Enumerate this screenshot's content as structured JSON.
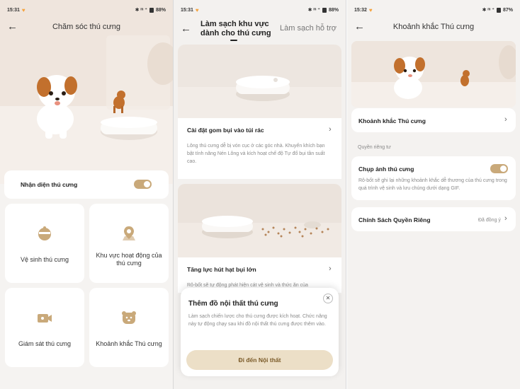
{
  "status": {
    "p1": {
      "time": "15:31",
      "indicators": "✱ ᵐ ⁺",
      "battery": "88%"
    },
    "p2": {
      "time": "15:31",
      "indicators": "✱ ᵐ ⁺",
      "battery": "88%"
    },
    "p3": {
      "time": "15:32",
      "indicators": "✱ ᵐ ⁺",
      "battery": "87%"
    }
  },
  "panel1": {
    "title": "Chăm sóc thú cưng",
    "recognition": {
      "label": "Nhận diện thú cưng",
      "enabled": true
    },
    "tiles": [
      {
        "label": "Vệ sinh thú cưng",
        "icon": "pet-cleaning-icon"
      },
      {
        "label": "Khu vực hoạt động của thú cưng",
        "icon": "location-pin-icon"
      },
      {
        "label": "Giám sát thú cưng",
        "icon": "video-camera-icon"
      },
      {
        "label": "Khoảnh khắc Thú cưng",
        "icon": "pet-face-icon"
      }
    ]
  },
  "panel2": {
    "tab_active": "Làm sạch khu vực dành cho thú cưng",
    "tab_inactive": "Làm sạch hỗ trợ",
    "features": [
      {
        "title": "Cài đặt gom bụi vào túi rác",
        "desc": "Lông thú cưng dễ bị vón cục ở các góc nhà. Khuyến khích bạn bật tính năng Nén Lông và kích hoạt chế độ Tự đổ bụi tần suất cao."
      },
      {
        "title": "Tăng lực hút hạt bụi lớn",
        "desc": "Rô-bốt sẽ tự động phát hiện cát vệ sinh và thức ăn của"
      }
    ],
    "popup": {
      "title": "Thêm đồ nội thất thú cưng",
      "desc": "Làm sạch chiến lược cho thú cưng được kích hoạt. Chức năng này tự động chạy sau khi đồ nội thất thú cưng được thêm vào.",
      "button": "Đi đến Nội thất"
    }
  },
  "panel3": {
    "title": "Khoảnh khắc Thú cưng",
    "moments_row": "Khoảnh khắc Thú cưng",
    "privacy_section": "Quyền riêng tư",
    "photo": {
      "label": "Chụp ảnh thú cưng",
      "enabled": true,
      "desc": "Rô-bốt sẽ ghi lại những khoảnh khắc dễ thương của thú cưng trong quá trình vệ sinh và lưu chúng dưới dạng GIF."
    },
    "policy": {
      "label": "Chính Sách Quyền Riêng",
      "status": "Đã đồng ý"
    }
  },
  "colors": {
    "accent": "#c9a97a",
    "button_bg": "#ecdfc7",
    "dog_brown": "#c2702d"
  }
}
